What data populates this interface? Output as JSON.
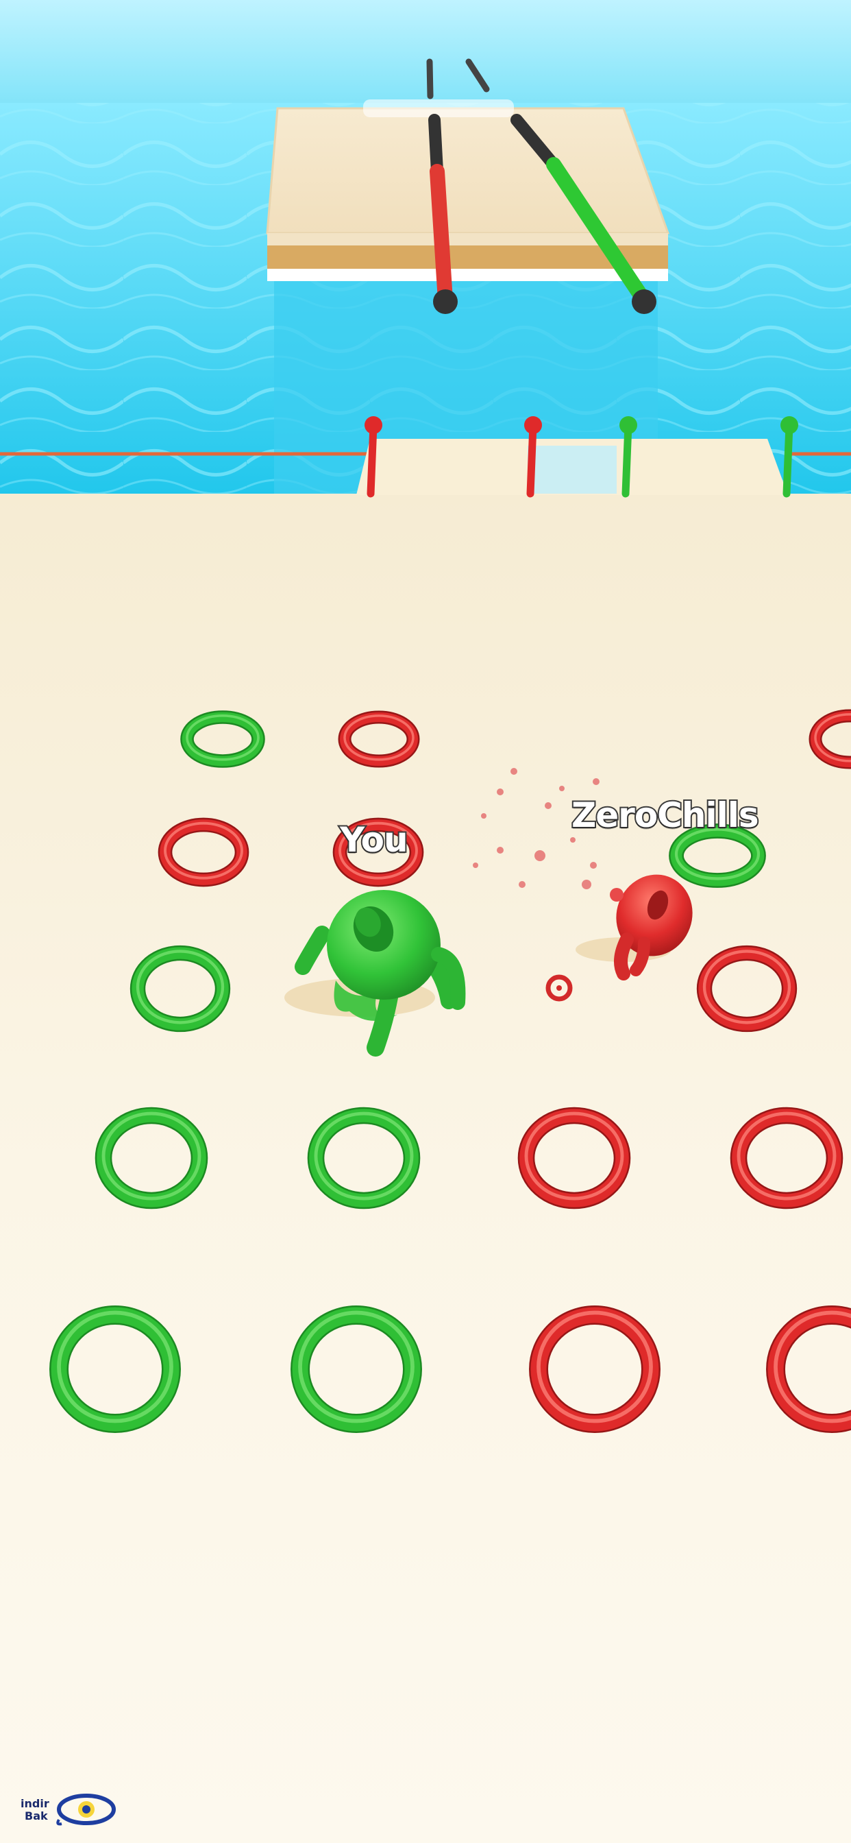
{
  "players": {
    "you_label": "You",
    "enemy_label": "ZeroChills"
  },
  "watermark": {
    "line1": "indir",
    "line2": "Bak"
  },
  "colors": {
    "player_green": "#2fbf35",
    "enemy_red": "#df2a2a",
    "floor": "#f8f0dc",
    "water": "#3fd3f2"
  },
  "icons": {
    "player_character": "green-donut-character-icon",
    "enemy_character": "red-donut-character-icon",
    "ring": "ring-icon",
    "pole": "pole-icon",
    "watermark_logo": "eye-logo-icon"
  },
  "rings": [
    {
      "color": "green"
    },
    {
      "color": "red"
    },
    {
      "color": "red"
    },
    {
      "color": "red"
    },
    {
      "color": "red"
    },
    {
      "color": "green"
    },
    {
      "color": "green"
    },
    {
      "color": "red"
    },
    {
      "color": "green"
    },
    {
      "color": "green"
    },
    {
      "color": "red"
    },
    {
      "color": "red"
    },
    {
      "color": "green"
    },
    {
      "color": "green"
    },
    {
      "color": "red"
    },
    {
      "color": "red"
    }
  ],
  "poles": [
    {
      "color": "red"
    },
    {
      "color": "red"
    },
    {
      "color": "green"
    },
    {
      "color": "green"
    }
  ],
  "bridge_rails": [
    {
      "color": "red"
    },
    {
      "color": "green"
    }
  ]
}
